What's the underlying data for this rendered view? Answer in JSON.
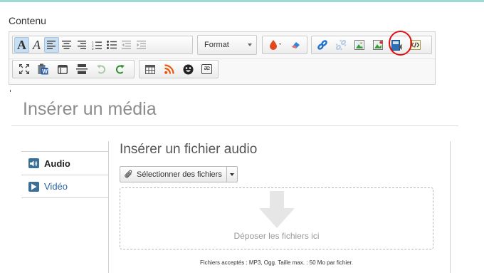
{
  "section_label": "Contenu",
  "toolbar": {
    "row1": {
      "group_text": [
        {
          "name": "text-color-button",
          "icon": "text-color-icon",
          "active": true
        },
        {
          "name": "italic-button",
          "icon": "italic-icon",
          "active": false
        },
        {
          "name": "align-left-button",
          "icon": "align-left-icon",
          "active": true
        },
        {
          "name": "align-center-button",
          "icon": "align-center-icon",
          "active": false
        },
        {
          "name": "align-right-button",
          "icon": "align-right-icon",
          "active": false
        },
        {
          "name": "numbered-list-button",
          "icon": "numbered-list-icon",
          "active": false
        },
        {
          "name": "bullet-list-button",
          "icon": "bullet-list-icon",
          "active": false
        },
        {
          "name": "outdent-button",
          "icon": "outdent-icon",
          "active": false
        },
        {
          "name": "indent-button",
          "icon": "indent-icon",
          "active": false
        }
      ],
      "format_label": "Format",
      "group_color": [
        {
          "name": "font-color-button",
          "icon": "drop-icon"
        },
        {
          "name": "eraser-button",
          "icon": "eraser-icon"
        }
      ],
      "group_media": [
        {
          "name": "link-button",
          "icon": "link-icon"
        },
        {
          "name": "unlink-button",
          "icon": "unlink-icon"
        },
        {
          "name": "insert-image-button",
          "icon": "image-icon"
        },
        {
          "name": "insert-gallery-button",
          "icon": "gallery-icon"
        },
        {
          "name": "insert-media-button",
          "icon": "media-icon"
        },
        {
          "name": "source-code-button",
          "icon": "code-icon"
        }
      ]
    },
    "row2": {
      "group_tools": [
        {
          "name": "fullscreen-button",
          "icon": "fullscreen-icon"
        },
        {
          "name": "paste-word-button",
          "icon": "paste-word-icon"
        },
        {
          "name": "template-button",
          "icon": "template-icon"
        },
        {
          "name": "page-break-button",
          "icon": "page-break-icon"
        },
        {
          "name": "undo-button",
          "icon": "undo-icon"
        },
        {
          "name": "redo-button",
          "icon": "redo-icon"
        }
      ],
      "group_insert": [
        {
          "name": "table-button",
          "icon": "table-icon"
        },
        {
          "name": "rss-button",
          "icon": "rss-icon"
        },
        {
          "name": "smiley-button",
          "icon": "smiley-icon"
        },
        {
          "name": "special-char-button",
          "icon": "special-char-icon",
          "glyph": "æ"
        }
      ]
    }
  },
  "colors": {
    "accent_active": "#c8def2",
    "annotation_circle": "#e01010",
    "link_blue": "#2b63a3",
    "icon_blue": "#3a6f97"
  },
  "modal": {
    "title": "Insérer un média",
    "tabs": [
      {
        "label": "Audio",
        "icon": "audio-icon",
        "active": true
      },
      {
        "label": "Vidéo",
        "icon": "play-icon",
        "active": false
      }
    ],
    "panel": {
      "heading": "Insérer un fichier audio",
      "select_button_label": "Sélectionner des fichiers",
      "dropzone_text": "Déposer les fichiers ici",
      "accepted_text": "Fichiers acceptés : MP3, Ogg. Taille max. : 50 Mo par fichier."
    }
  }
}
